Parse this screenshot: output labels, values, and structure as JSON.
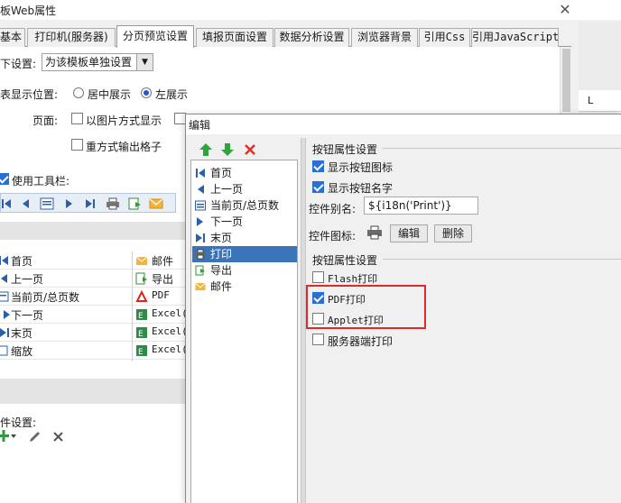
{
  "window": {
    "title": "板Web属性",
    "close_glyph": "✕"
  },
  "tabs": [
    {
      "label": "基本",
      "active": false
    },
    {
      "label": "打印机(服务器)",
      "active": false
    },
    {
      "label": "分页预览设置",
      "active": true
    },
    {
      "label": "填报页面设置",
      "active": false
    },
    {
      "label": "数据分析设置",
      "active": false
    },
    {
      "label": "浏览器背景",
      "active": false
    },
    {
      "label": "引用Css",
      "active": false
    },
    {
      "label": "引用JavaScript",
      "active": false
    }
  ],
  "ruler_label": "L",
  "settings": {
    "row1_label": "下设置:",
    "row1_value": "为该模板单独设置",
    "position_label": "表显示位置:",
    "center_option": "居中展示",
    "left_option": "左展示",
    "position_selected": "left",
    "page_label": "页面:",
    "image_mode": "以图片方式显示",
    "repeat_cells": "重方式输出格子",
    "use_toolbar": "使用工具栏:"
  },
  "button_table": {
    "left": [
      "首页",
      "上一页",
      "当前页/总页数",
      "下一页",
      "末页",
      "缩放"
    ],
    "right": [
      "邮件",
      "导出",
      "PDF",
      "Excel(",
      "Excel(",
      "Excel("
    ]
  },
  "event_settings": {
    "label": "件设置:"
  },
  "dialog": {
    "title": "编辑",
    "list_items": [
      "首页",
      "上一页",
      "当前页/总页数",
      "下一页",
      "末页",
      "打印",
      "导出",
      "邮件"
    ],
    "selected_index": 5,
    "group1_title": "按钮属性设置",
    "show_icon": "显示按钮图标",
    "show_name": "显示按钮名字",
    "alias_label": "控件别名:",
    "alias_value": "${i18n('Print')}",
    "icon_label": "控件图标:",
    "edit_button": "编辑",
    "delete_button": "删除",
    "group2_title": "按钮属性设置",
    "flash_print": "Flash打印",
    "pdf_print": "PDF打印",
    "applet_print": "Applet打印",
    "server_print": "服务器端打印"
  }
}
